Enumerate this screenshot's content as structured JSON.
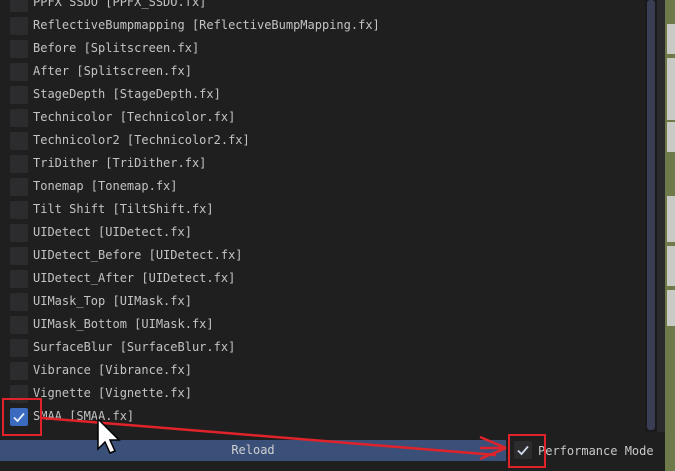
{
  "effects": [
    {
      "label": "PPFX SSDO [PPFX_SSDO.fx]",
      "checked": false
    },
    {
      "label": "ReflectiveBumpmapping [ReflectiveBumpMapping.fx]",
      "checked": false
    },
    {
      "label": "Before [Splitscreen.fx]",
      "checked": false
    },
    {
      "label": "After [Splitscreen.fx]",
      "checked": false
    },
    {
      "label": "StageDepth [StageDepth.fx]",
      "checked": false
    },
    {
      "label": "Technicolor [Technicolor.fx]",
      "checked": false
    },
    {
      "label": "Technicolor2 [Technicolor2.fx]",
      "checked": false
    },
    {
      "label": "TriDither [TriDither.fx]",
      "checked": false
    },
    {
      "label": "Tonemap [Tonemap.fx]",
      "checked": false
    },
    {
      "label": "Tilt Shift [TiltShift.fx]",
      "checked": false
    },
    {
      "label": "UIDetect [UIDetect.fx]",
      "checked": false
    },
    {
      "label": "UIDetect_Before [UIDetect.fx]",
      "checked": false
    },
    {
      "label": "UIDetect_After [UIDetect.fx]",
      "checked": false
    },
    {
      "label": "UIMask_Top [UIMask.fx]",
      "checked": false
    },
    {
      "label": "UIMask_Bottom [UIMask.fx]",
      "checked": false
    },
    {
      "label": "SurfaceBlur [SurfaceBlur.fx]",
      "checked": false
    },
    {
      "label": "Vibrance [Vibrance.fx]",
      "checked": false
    },
    {
      "label": "Vignette [Vignette.fx]",
      "checked": false
    },
    {
      "label": "SMAA [SMAA.fx]",
      "checked": true
    }
  ],
  "footer": {
    "reload_label": "Reload",
    "performance_mode_label": "Performance Mode",
    "performance_mode_checked": true
  },
  "colors": {
    "accent": "#3a6bbf",
    "reload_button": "#3a5078",
    "annotation": "#e0232a"
  },
  "icons": {
    "checkbox_check": "check-icon",
    "cursor": "mouse-cursor-icon",
    "annotation_arrow": "arrow-icon"
  }
}
